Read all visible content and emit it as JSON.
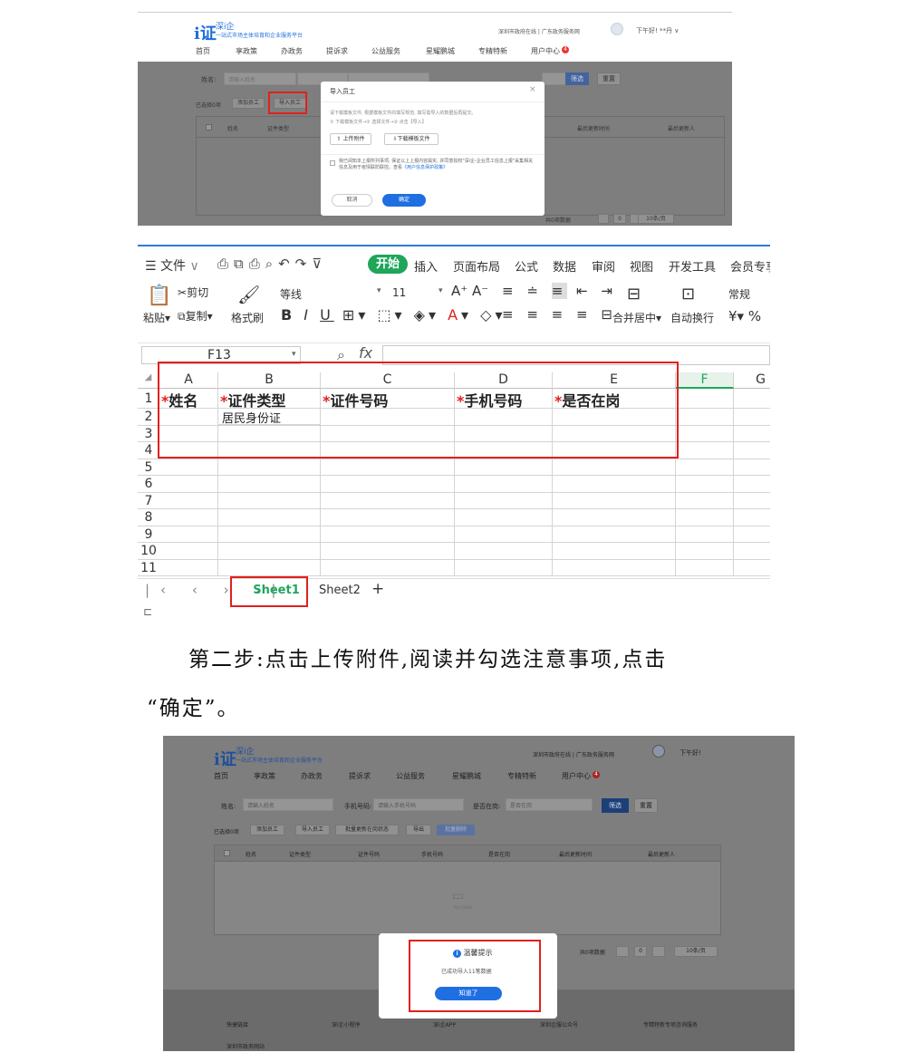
{
  "screenshot1": {
    "logo_mark": "i证",
    "logo_name": "深i企",
    "logo_sub": "一站式市场主体培育和企业服务平台",
    "top_links": "深圳市政府在线  |  广东政务服务网",
    "greeting": "下午好! **丹 ∨",
    "nav": [
      "首页",
      "享政策",
      "办政务",
      "提诉求",
      "公益服务",
      "星耀鹏城",
      "专精特新",
      "用户中心"
    ],
    "nav_badge": "4",
    "filter_name_label": "姓名:",
    "filter_name_placeholder": "请输入姓名",
    "filter_phone_label": "手机号码:",
    "filter_phone_placeholder": "请输入手机号码",
    "filter_onjob_label": "是否在岗:",
    "search_btn": "筛选",
    "reset_btn": "重置",
    "selected_count": "已选择0项",
    "add_employee": "添加员工",
    "import_employee": "导入员工",
    "table_headers": [
      "姓名",
      "证件类型",
      "证件号码",
      "手机号码",
      "是否在岗",
      "最后更新时间",
      "最后更新人"
    ],
    "pager_total": "共0项数据",
    "pager_page": "0",
    "pager_size": "10条/页",
    "modal": {
      "title": "导入员工",
      "close": "×",
      "hint1": "请下载模板文件, 根据模板文件的填写规范, 填写需导入的数据后再提交。",
      "hint2": "① 下载模板文件→② 选择文件→③ 点击【导入】",
      "upload_btn": "上传附件",
      "download_btn": "下载模板文件",
      "agree_text": "我已阅知本上报所列事项, 保证以上上报内容属实, 并同意授权\"深i企-企业员工信息上报\"采集相关信息及用于疫情联防联控。查看",
      "agree_link": "《用户信息保护政策》",
      "cancel": "取消",
      "confirm": "确定"
    }
  },
  "excel": {
    "menu_label": "文件",
    "tabs": [
      "开始",
      "插入",
      "页面布局",
      "公式",
      "数据",
      "审阅",
      "视图",
      "开发工具",
      "会员专享"
    ],
    "cut": "剪切",
    "copy": "复制",
    "paste": "粘贴",
    "format_painter": "格式刷",
    "font_name": "等线",
    "font_size": "11",
    "merge_center": "合并居中",
    "wrap_text": "自动换行",
    "number_format": "常规",
    "cell_ref": "F13",
    "fx": "fx",
    "columns": [
      "A",
      "B",
      "C",
      "D",
      "E",
      "F",
      "G"
    ],
    "rows": [
      "1",
      "2",
      "3",
      "4",
      "5",
      "6",
      "7",
      "8",
      "9",
      "10",
      "11"
    ],
    "header_cells": [
      "姓名",
      "证件类型",
      "证件号码",
      "手机号码",
      "是否在岗"
    ],
    "b2": "居民身份证",
    "sheet1": "Sheet1",
    "sheet2": "Sheet2"
  },
  "step_text_line1": "第二步:点击上传附件,阅读并勾选注意事项,点击",
  "step_text_line2": "“确定”。",
  "screenshot2": {
    "logo_mark": "i证",
    "logo_name": "深i企",
    "logo_sub": "一站式市场主体培育和企业服务平台",
    "top_links": "深圳市政府在线  |  广东政务服务网",
    "greeting": "下午好!",
    "nav": [
      "首页",
      "享政策",
      "办政务",
      "提诉求",
      "公益服务",
      "星耀鹏城",
      "专精特新",
      "用户中心"
    ],
    "nav_badge": "4",
    "filter_name_label": "姓名:",
    "filter_name_placeholder": "请输入姓名",
    "filter_phone_label": "手机号码:",
    "filter_phone_placeholder": "请输入手机号码",
    "filter_onjob_label": "是否在岗:",
    "filter_onjob_placeholder": "是否在岗",
    "search_btn": "筛选",
    "reset_btn": "重置",
    "selected_count": "已选择0项",
    "actions": [
      "添加员工",
      "导入员工",
      "批量更新在岗状态",
      "导出",
      "批量删除"
    ],
    "table_headers": [
      "姓名",
      "证件类型",
      "证件号码",
      "手机号码",
      "是否在岗",
      "最后更新时间",
      "最后更新人"
    ],
    "no_data": "No Data",
    "pager_total": "共0项数据",
    "pager_page": "0",
    "pager_size": "10条/页",
    "footer": [
      "快捷链接",
      "深i企小程序",
      "深i企APP",
      "深圳企服公众号",
      "专精特新专项咨询服务"
    ],
    "footer_sub": "深圳市政务网站",
    "popup": {
      "icon": "i",
      "title": "温馨提示",
      "message": "已成功导入11笔数据",
      "button": "知道了"
    }
  }
}
